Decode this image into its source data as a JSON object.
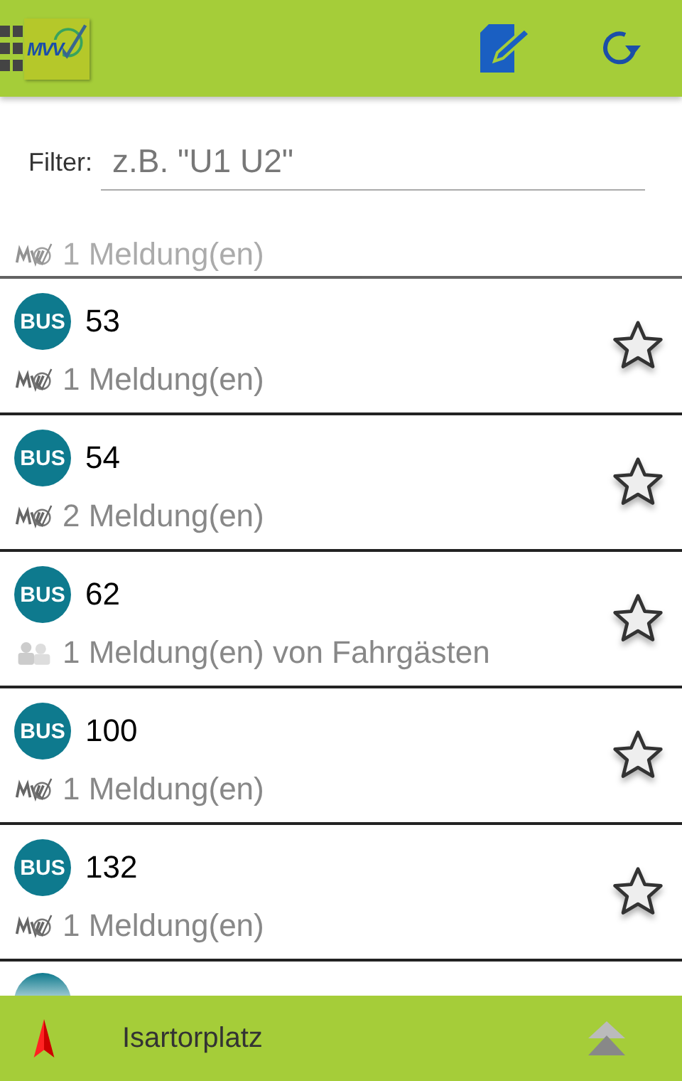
{
  "app_bar": {
    "logo": "MVV"
  },
  "filter": {
    "label": "Filter:",
    "placeholder": "z.B. \"U1 U2\""
  },
  "partial_top": {
    "kind": "mvv",
    "message": "1 Meldung(en)"
  },
  "lines": [
    {
      "badge": "BUS",
      "number": "53",
      "kind": "mvv",
      "message": "1 Meldung(en)",
      "starred": false
    },
    {
      "badge": "BUS",
      "number": "54",
      "kind": "mvv",
      "message": "2 Meldung(en)",
      "starred": false
    },
    {
      "badge": "BUS",
      "number": "62",
      "kind": "passengers",
      "message": "1 Meldung(en) von Fahrgästen",
      "starred": false
    },
    {
      "badge": "BUS",
      "number": "100",
      "kind": "mvv",
      "message": "1 Meldung(en)",
      "starred": false
    },
    {
      "badge": "BUS",
      "number": "132",
      "kind": "mvv",
      "message": "1 Meldung(en)",
      "starred": false
    }
  ],
  "bottom_bar": {
    "station": "Isartorplatz"
  }
}
